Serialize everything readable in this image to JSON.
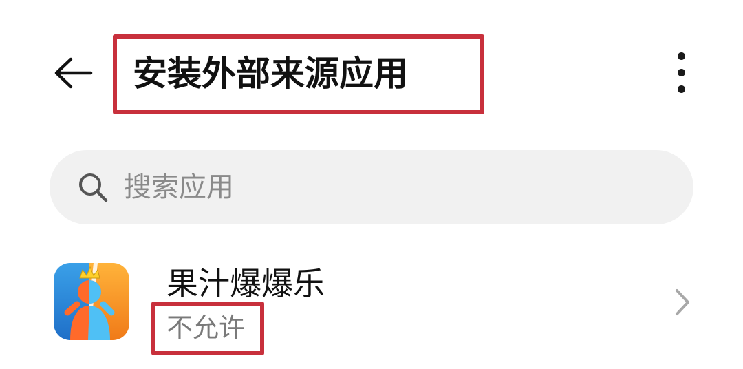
{
  "header": {
    "title": "安装外部来源应用",
    "back_icon": "arrow-left-icon",
    "more_icon": "more-vertical-icon"
  },
  "search": {
    "placeholder": "搜索应用",
    "icon": "search-icon"
  },
  "apps": [
    {
      "name": "果汁爆爆乐",
      "status": "不允许",
      "icon": "app-icon-juice-game"
    }
  ],
  "colors": {
    "highlight_border": "#c8303c",
    "search_bg": "#f1f1f1",
    "secondary_text": "#7a7a7a"
  }
}
